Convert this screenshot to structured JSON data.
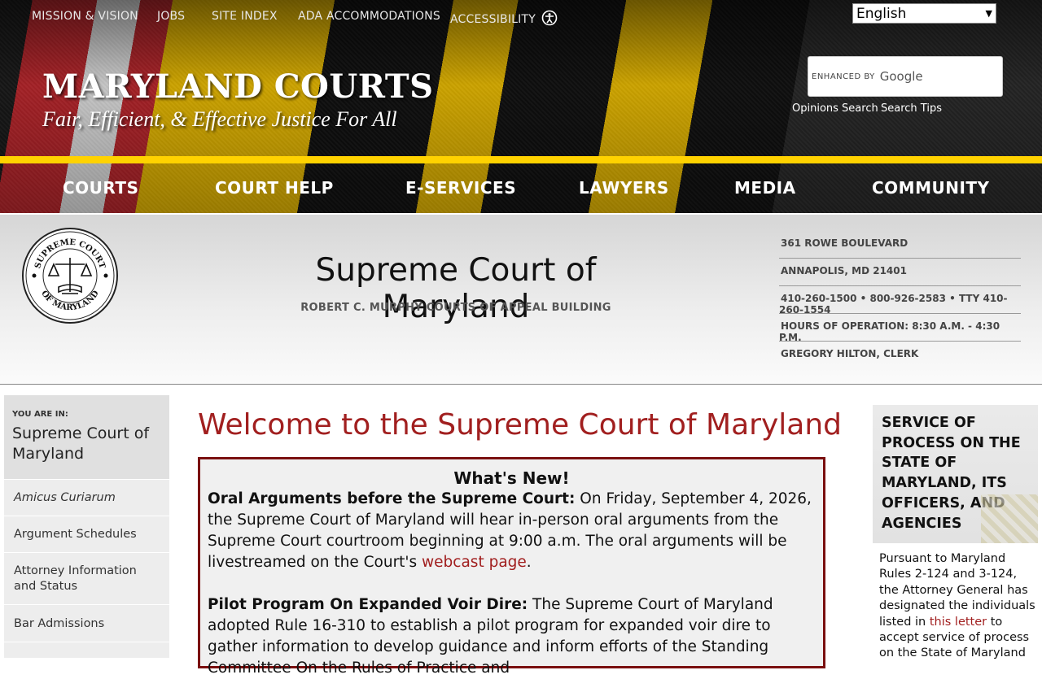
{
  "topbar": {
    "links": [
      "MISSION & VISION",
      "JOBS",
      "SITE INDEX",
      "ADA ACCOMMODATIONS",
      "ACCESSIBILITY"
    ],
    "language": "English"
  },
  "brand": {
    "name": "MARYLAND COURTS",
    "tagline": "Fair, Efficient, & Effective Justice For All"
  },
  "search": {
    "enhanced": "ENHANCED BY",
    "provider": "Google",
    "links": [
      "Opinions Search",
      "Search Tips"
    ]
  },
  "nav": [
    "COURTS",
    "COURT HELP",
    "E-SERVICES",
    "LAWYERS",
    "MEDIA",
    "COMMUNITY"
  ],
  "court": {
    "title": "Supreme Court of Maryland",
    "building": "ROBERT C. MURPHY COURTS OF APPEAL BUILDING",
    "seal_text_top": "SUPREME COURT",
    "seal_text_bottom": "OF MARYLAND",
    "contact": [
      "361 ROWE BOULEVARD",
      "ANNAPOLIS, MD 21401",
      "410-260-1500 • 800-926-2583 • TTY 410-260-1554",
      "HOURS OF OPERATION: 8:30 A.M. - 4:30 P.M.",
      "GREGORY HILTON, CLERK"
    ]
  },
  "sidebar": {
    "you_are_in_label": "YOU ARE IN:",
    "current": "Supreme Court of Maryland",
    "items": [
      "Amicus Curiarum",
      "Argument Schedules",
      "Attorney Information and Status",
      "Bar Admissions"
    ]
  },
  "main": {
    "welcome": "Welcome to the Supreme Court of Maryland",
    "whats_new_title": "What's New!",
    "item1_title": "Oral Arguments before the Supreme Court:",
    "item1_text": " On Friday, September 4, 2026, the Supreme Court of Maryland will hear in-person oral arguments from the Supreme Court courtroom beginning at 9:00 a.m. The oral arguments will be livestreamed on the Court's ",
    "item1_link": "webcast page",
    "item1_end": ".",
    "item2_title": "Pilot Program On Expanded Voir Dire:",
    "item2_text": " The Supreme Court of Maryland adopted Rule 16-310 to establish a pilot program for expanded voir dire to gather information to develop guidance and inform efforts of the Standing Committee On the Rules of Practice and"
  },
  "right": {
    "heading": "SERVICE OF PROCESS ON THE STATE OF MARYLAND, ITS OFFICERS, AND AGENCIES",
    "text1": "Pursuant to Maryland Rules 2-124 and 3-124, the Attorney General has designated the individuals listed in ",
    "link": "this letter",
    "text2": " to accept service of process on the State of Maryland"
  },
  "colors": {
    "accent_red": "#a11f1f",
    "flag_yellow": "#ffd200",
    "border_red": "#7a0f0f"
  }
}
